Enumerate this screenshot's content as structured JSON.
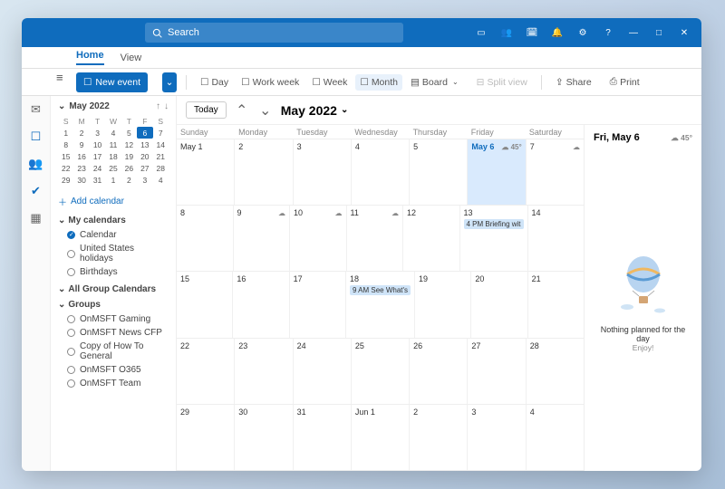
{
  "search": {
    "placeholder": "Search"
  },
  "titlebar_icons": [
    "meet-now-icon",
    "teams-icon",
    "mail-icon",
    "bell-icon",
    "gear-icon",
    "help-icon",
    "minimize-icon",
    "maximize-icon",
    "close-icon"
  ],
  "ribbon": {
    "tabs": [
      "Home",
      "View"
    ],
    "active": 0
  },
  "toolbar": {
    "new_event": "New event",
    "views": [
      {
        "label": "Day",
        "icon": "☐"
      },
      {
        "label": "Work week",
        "icon": "☐"
      },
      {
        "label": "Week",
        "icon": "☐"
      },
      {
        "label": "Month",
        "icon": "☐",
        "active": true
      },
      {
        "label": "Board",
        "icon": "▤"
      }
    ],
    "split_view": "Split view",
    "share": "Share",
    "print": "Print"
  },
  "mini_cal": {
    "title": "May 2022",
    "dow": [
      "S",
      "M",
      "T",
      "W",
      "T",
      "F",
      "S"
    ],
    "weeks": [
      [
        "1",
        "2",
        "3",
        "4",
        "5",
        "6",
        "7"
      ],
      [
        "8",
        "9",
        "10",
        "11",
        "12",
        "13",
        "14"
      ],
      [
        "15",
        "16",
        "17",
        "18",
        "19",
        "20",
        "21"
      ],
      [
        "22",
        "23",
        "24",
        "25",
        "26",
        "27",
        "28"
      ],
      [
        "29",
        "30",
        "31",
        "1",
        "2",
        "3",
        "4"
      ]
    ],
    "today": "6"
  },
  "sidebar": {
    "add_calendar": "Add calendar",
    "sections": [
      {
        "title": "My calendars",
        "items": [
          {
            "label": "Calendar",
            "checked": true
          },
          {
            "label": "United States holidays",
            "checked": false
          },
          {
            "label": "Birthdays",
            "checked": false
          }
        ]
      },
      {
        "title": "All Group Calendars",
        "items": []
      },
      {
        "title": "Groups",
        "items": [
          {
            "label": "OnMSFT Gaming",
            "checked": false
          },
          {
            "label": "OnMSFT News CFP",
            "checked": false
          },
          {
            "label": "Copy of How To General",
            "checked": false
          },
          {
            "label": "OnMSFT O365",
            "checked": false
          },
          {
            "label": "OnMSFT Team",
            "checked": false
          }
        ]
      }
    ]
  },
  "main": {
    "today_btn": "Today",
    "title": "May 2022",
    "dow": [
      "Sunday",
      "Monday",
      "Tuesday",
      "Wednesday",
      "Thursday",
      "Friday",
      "Saturday"
    ],
    "weeks": [
      [
        {
          "n": "May 1"
        },
        {
          "n": "2"
        },
        {
          "n": "3"
        },
        {
          "n": "4"
        },
        {
          "n": "5"
        },
        {
          "n": "May 6",
          "today": true,
          "wx": "☁ 45°"
        },
        {
          "n": "7",
          "wx": "☁"
        }
      ],
      [
        {
          "n": "8"
        },
        {
          "n": "9",
          "wx": "☁"
        },
        {
          "n": "10",
          "wx": "☁"
        },
        {
          "n": "11",
          "wx": "☁"
        },
        {
          "n": "12"
        },
        {
          "n": "13",
          "ev": "4 PM Briefing wit"
        },
        {
          "n": "14"
        }
      ],
      [
        {
          "n": "15"
        },
        {
          "n": "16"
        },
        {
          "n": "17"
        },
        {
          "n": "18",
          "ev": "9 AM See What's"
        },
        {
          "n": "19"
        },
        {
          "n": "20"
        },
        {
          "n": "21"
        }
      ],
      [
        {
          "n": "22"
        },
        {
          "n": "23"
        },
        {
          "n": "24"
        },
        {
          "n": "25"
        },
        {
          "n": "26"
        },
        {
          "n": "27"
        },
        {
          "n": "28"
        }
      ],
      [
        {
          "n": "29"
        },
        {
          "n": "30"
        },
        {
          "n": "31"
        },
        {
          "n": "Jun 1"
        },
        {
          "n": "2"
        },
        {
          "n": "3"
        },
        {
          "n": "4"
        }
      ]
    ]
  },
  "day_pane": {
    "title": "Fri, May 6",
    "wx": "☁ 45°",
    "empty": "Nothing planned for the day",
    "sub": "Enjoy!"
  }
}
